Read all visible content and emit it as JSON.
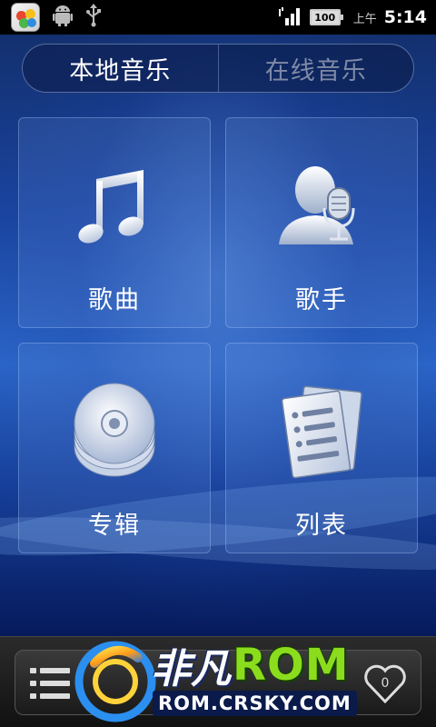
{
  "status_bar": {
    "battery_level": "100",
    "ampm": "上午",
    "time": "5:14",
    "icons": [
      "app-store-icon",
      "android-debug-icon",
      "usb-icon",
      "signal-icon",
      "battery-icon"
    ]
  },
  "tabs": [
    {
      "label": "本地音乐",
      "active": true
    },
    {
      "label": "在线音乐",
      "active": false
    }
  ],
  "tiles": [
    {
      "label": "歌曲",
      "icon": "music-note-icon"
    },
    {
      "label": "歌手",
      "icon": "artist-microphone-icon"
    },
    {
      "label": "专辑",
      "icon": "album-disc-icon"
    },
    {
      "label": "列表",
      "icon": "playlist-document-icon"
    }
  ],
  "bottom_bar": {
    "favorites_count": "0",
    "icons": [
      "list-icon",
      "heart-icon"
    ]
  },
  "watermark": {
    "title_cn": "非凡",
    "title_rom": "ROM",
    "url": "ROM.CRSKY.COM"
  },
  "colors": {
    "background_top": "#13306e",
    "background_mid": "#2a64c6",
    "background_bottom": "#061a5a",
    "tab_active_text": "#ffffff",
    "tab_inactive_text": "#7f8aa6",
    "watermark_green": "#8cdc1e"
  }
}
